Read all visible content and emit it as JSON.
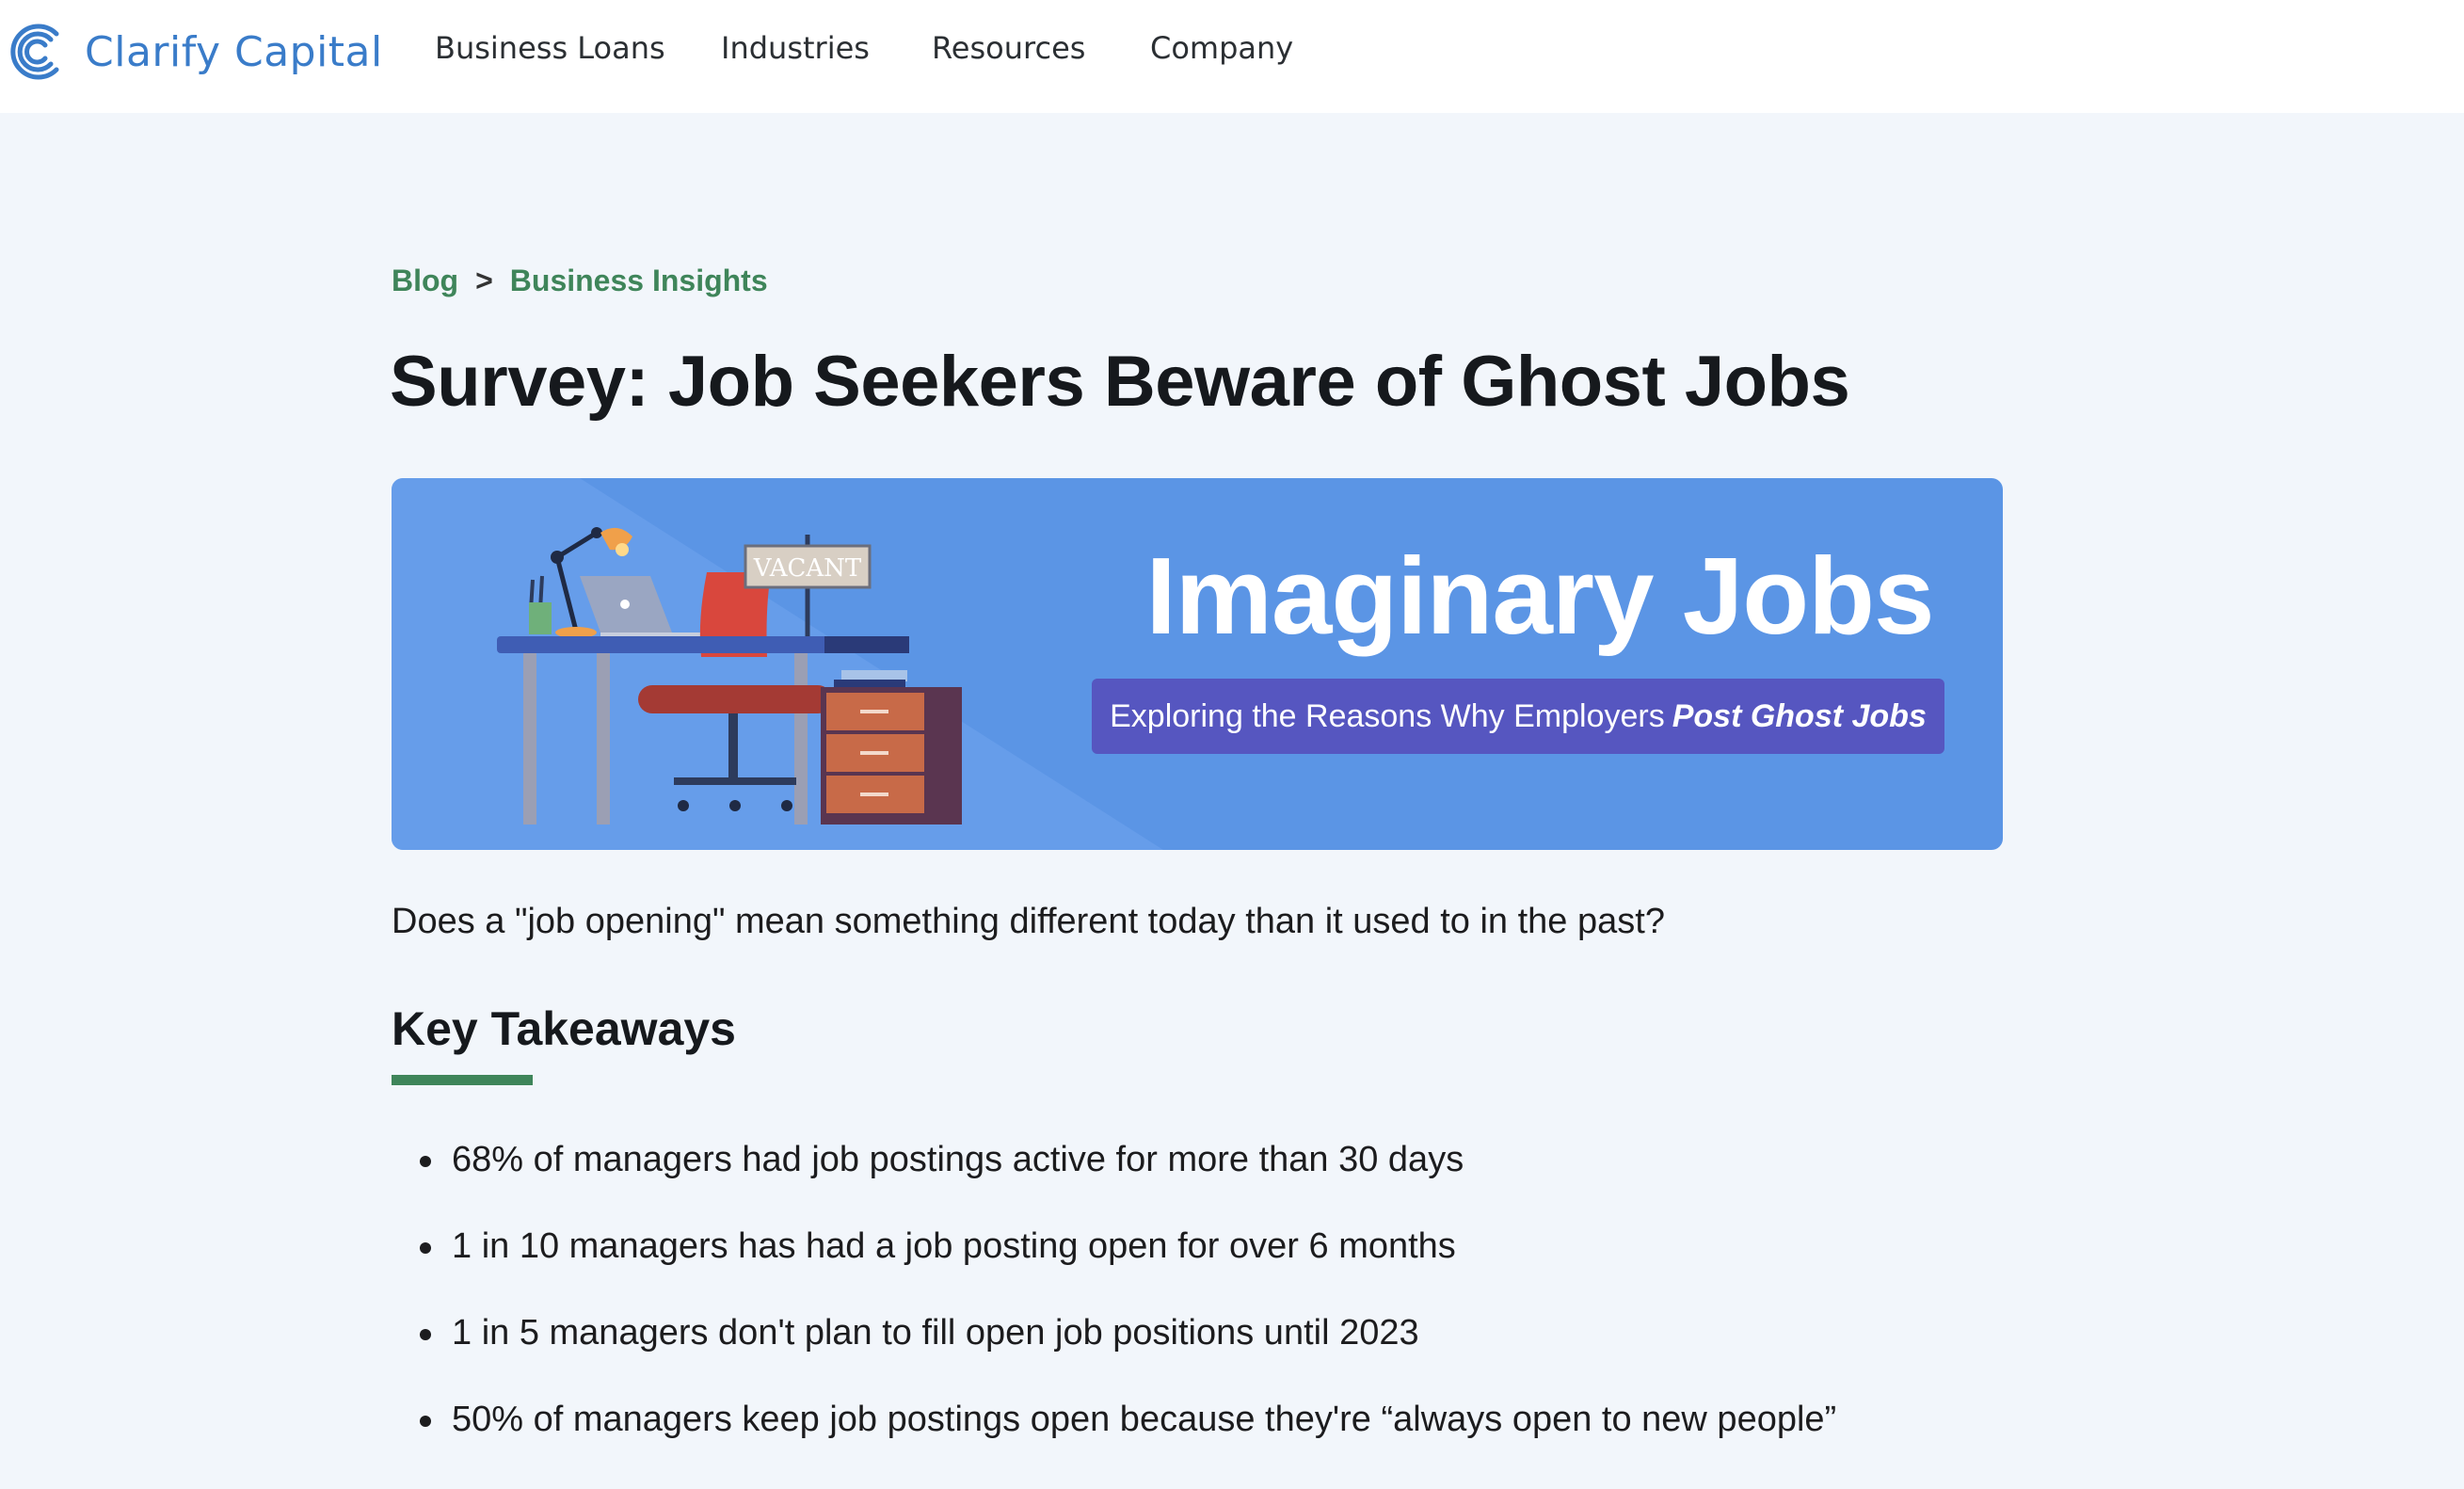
{
  "header": {
    "brand": "Clarify Capital",
    "nav": [
      "Business Loans",
      "Industries",
      "Resources",
      "Company"
    ]
  },
  "breadcrumb": {
    "items": [
      "Blog",
      "Business Insights"
    ],
    "separator": ">"
  },
  "article": {
    "title": "Survey: Job Seekers Beware of Ghost Jobs",
    "hero": {
      "sign_text": "VACANT",
      "title": "Imaginary Jobs",
      "subtitle_plain": "Exploring the Reasons Why Employers",
      "subtitle_emph": "Post Ghost Jobs"
    },
    "lede": "Does a \"job opening\" mean something different today than it used to in the past?",
    "key_takeaways": {
      "heading": "Key Takeaways",
      "items": [
        "68% of managers had job postings active for more than 30 days",
        "1 in 10 managers has had a job posting open for over 6 months",
        "1 in 5 managers don't plan to fill open job positions until 2023",
        "50% of managers keep job postings open because they're “always open to new people”"
      ]
    }
  },
  "colors": {
    "brand_blue": "#3a7cc9",
    "accent_green": "#3f855a",
    "hero_blue": "#5b95e5",
    "hero_badge": "#5656c0",
    "page_bg": "#f2f6fb"
  }
}
